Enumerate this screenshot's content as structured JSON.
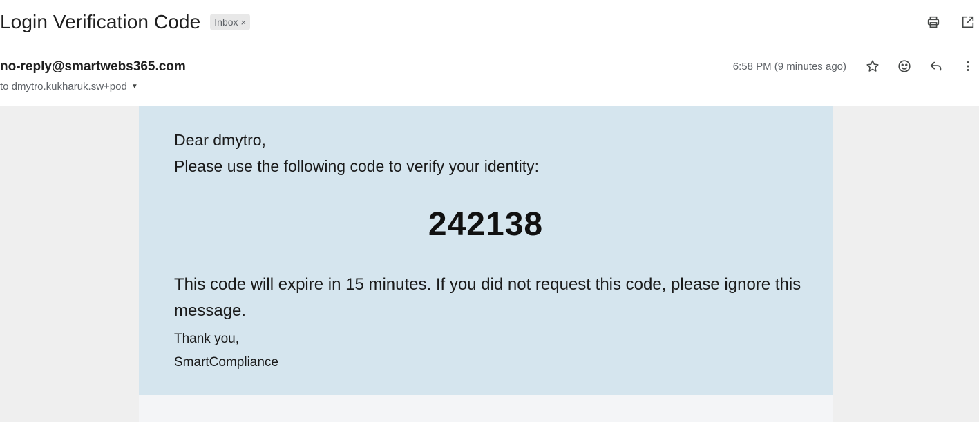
{
  "email": {
    "subject": "Login Verification Code",
    "label": "Inbox",
    "label_remove": "×",
    "sender": "no-reply@smartwebs365.com",
    "recipient": "to dmytro.kukharuk.sw+pod",
    "timestamp": "6:58 PM (9 minutes ago)"
  },
  "icons": {
    "print": "print-icon",
    "open_new_window": "open-in-new-window-icon",
    "star": "star-icon",
    "emoji": "emoji-reaction-icon",
    "reply": "reply-icon",
    "more": "more-vertical-icon",
    "recipient_caret": "caret-down-icon"
  },
  "message": {
    "greeting": "Dear dmytro,",
    "instruction": "Please use the following code to verify your identity:",
    "code": "242138",
    "expiry": "This code will expire in 15 minutes. If you did not request this code, please ignore this message.",
    "thanks": "Thank you,",
    "signature": "SmartCompliance"
  },
  "colors": {
    "card_background": "#d5e5ee",
    "page_background": "#efefef"
  }
}
